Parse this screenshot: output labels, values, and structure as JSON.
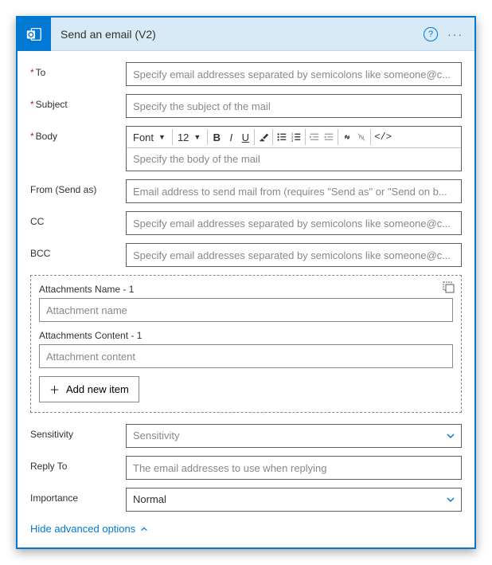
{
  "header": {
    "title": "Send an email (V2)"
  },
  "fields": {
    "to_label": "To",
    "to_placeholder": "Specify email addresses separated by semicolons like someone@c...",
    "subject_label": "Subject",
    "subject_placeholder": "Specify the subject of the mail",
    "body_label": "Body",
    "body_placeholder": "Specify the body of the mail",
    "from_label": "From (Send as)",
    "from_placeholder": "Email address to send mail from (requires \"Send as\" or \"Send on b...",
    "cc_label": "CC",
    "cc_placeholder": "Specify email addresses separated by semicolons like someone@c...",
    "bcc_label": "BCC",
    "bcc_placeholder": "Specify email addresses separated by semicolons like someone@c...",
    "sensitivity_label": "Sensitivity",
    "sensitivity_placeholder": "Sensitivity",
    "replyto_label": "Reply To",
    "replyto_placeholder": "The email addresses to use when replying",
    "importance_label": "Importance",
    "importance_value": "Normal"
  },
  "toolbar": {
    "font_label": "Font",
    "size_label": "12"
  },
  "attachments": {
    "name_label": "Attachments Name - 1",
    "name_placeholder": "Attachment name",
    "content_label": "Attachments Content - 1",
    "content_placeholder": "Attachment content",
    "add_label": "Add new item"
  },
  "footer": {
    "hide_label": "Hide advanced options"
  }
}
